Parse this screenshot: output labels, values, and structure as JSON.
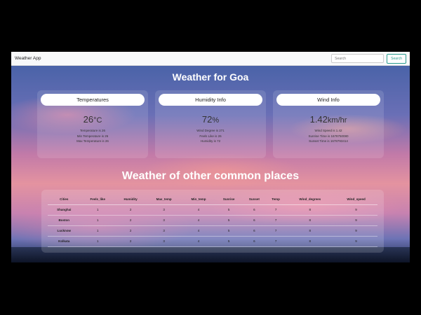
{
  "navbar": {
    "brand": "Weather App",
    "search_placeholder": "Search",
    "search_button": "Search"
  },
  "main": {
    "title": "Weather for Goa"
  },
  "cards": [
    {
      "header": "Temperatures",
      "value": "26",
      "unit": "°C",
      "lines": [
        "Temperature is 26",
        "Min Temperature is 26",
        "Max Temperature is 26"
      ]
    },
    {
      "header": "Humidity Info",
      "value": "72",
      "unit": "%",
      "lines": [
        "Wind Degree is 271",
        "Feels Like is 26",
        "Humidity is 72"
      ]
    },
    {
      "header": "Wind Info",
      "value": "1.42",
      "unit": "km/hr",
      "lines": [
        "Wind Speed is 1.42",
        "Sunrise Time is 1678750080",
        "Sunset Time is 1678793414"
      ]
    }
  ],
  "other": {
    "title": "Weather of other common places",
    "columns": [
      "Cities",
      "Feels_like",
      "Humidity",
      "Max_temp",
      "Min_temp",
      "Sunrise",
      "Sunset",
      "Temp",
      "Wind_degrees",
      "Wind_speed"
    ],
    "rows": [
      [
        "Shanghai",
        "1",
        "2",
        "3",
        "4",
        "5",
        "6",
        "7",
        "8",
        "9"
      ],
      [
        "Boston",
        "1",
        "2",
        "3",
        "4",
        "5",
        "6",
        "7",
        "8",
        "9"
      ],
      [
        "Lucknow",
        "1",
        "2",
        "3",
        "4",
        "5",
        "6",
        "7",
        "8",
        "9"
      ],
      [
        "Kolkata",
        "1",
        "2",
        "3",
        "4",
        "5",
        "6",
        "7",
        "8",
        "9"
      ]
    ]
  }
}
